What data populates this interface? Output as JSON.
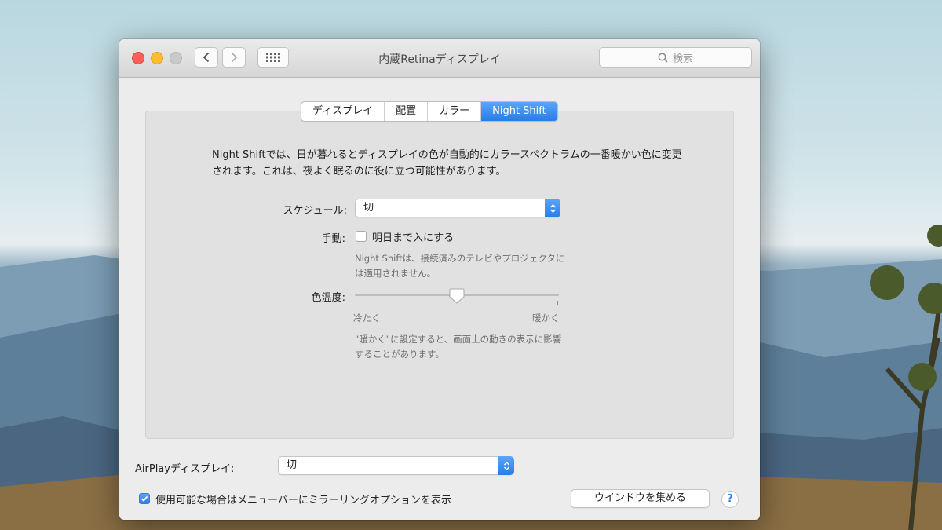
{
  "window": {
    "title": "内蔵Retinaディスプレイ"
  },
  "search": {
    "placeholder": "検索"
  },
  "tabs": [
    {
      "label": "ディスプレイ",
      "active": false
    },
    {
      "label": "配置",
      "active": false
    },
    {
      "label": "カラー",
      "active": false
    },
    {
      "label": "Night Shift",
      "active": true
    }
  ],
  "night_shift": {
    "description": "Night Shiftでは、日が暮れるとディスプレイの色が自動的にカラースペクトラムの一番暖かい色に変更されます。これは、夜よく眠るのに役に立つ可能性があります。",
    "schedule_label": "スケジュール:",
    "schedule_value": "切",
    "manual_label": "手動:",
    "manual_checkbox_label": "明日まで入にする",
    "manual_checked": false,
    "note": "Night Shiftは、接続済みのテレビやプロジェクタには適用されません。",
    "temperature_label": "色温度:",
    "temperature_level": 0.5,
    "cooler_label": "冷たく",
    "warmer_label": "暖かく",
    "warning": "\"暖かく\"に設定すると、画面上の動きの表示に影響することがあります。"
  },
  "airplay": {
    "label": "AirPlayディスプレイ:",
    "value": "切",
    "mirroring_label": "使用可能な場合はメニューバーにミラーリングオプションを表示",
    "mirroring_checked": true
  },
  "buttons": {
    "gather_windows": "ウインドウを集める",
    "help": "?"
  },
  "colors": {
    "accent": "#2a7de6",
    "close": "#fc5f57",
    "minimize": "#fdbc2e",
    "maximize": "#c9c9c9"
  }
}
